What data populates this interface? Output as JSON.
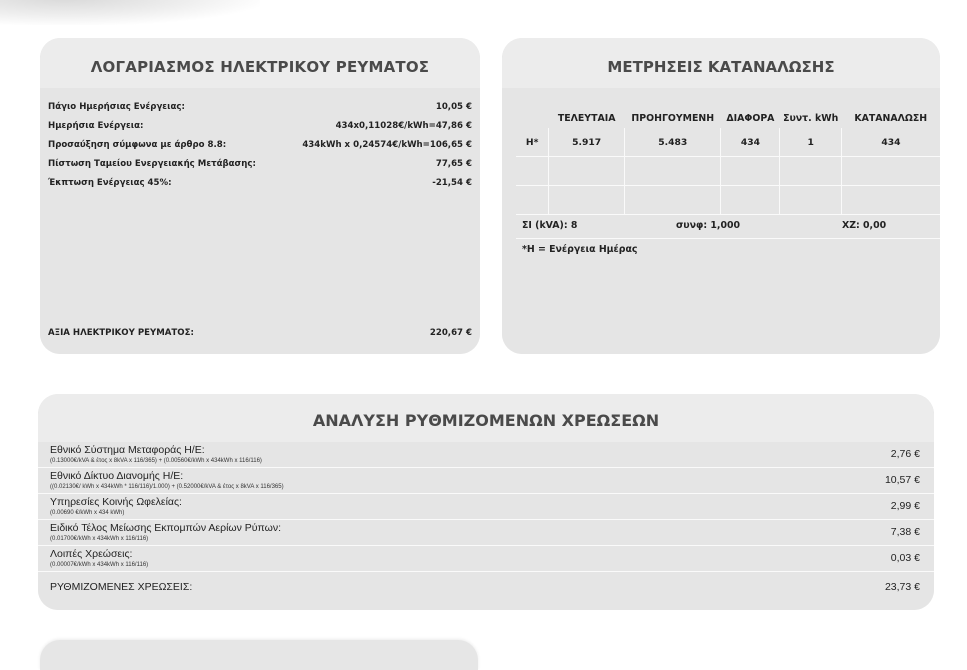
{
  "electricity_bill": {
    "title": "ΛΟΓΑΡΙΑΣΜΟΣ ΗΛΕΚΤΡΙΚΟΥ ΡΕΥΜΑΤΟΣ",
    "rows": [
      {
        "label": "Πάγιο Ημερήσιας Ενέργειας:",
        "value": "10,05 €"
      },
      {
        "label": "Ημερήσια Ενέργεια:",
        "value": "434x0,11028€/kWh=47,86 €"
      },
      {
        "label": "Προσαύξηση σύμφωνα με άρθρο 8.8:",
        "value": "434kWh x 0,24574€/kWh=106,65 €"
      },
      {
        "label": "Πίστωση Ταμείου Ενεργειακής Μετάβασης:",
        "value": "77,65 €"
      },
      {
        "label": "Έκπτωση Ενέργειας 45%:",
        "value": "-21,54 €"
      }
    ],
    "total_label": "ΑΞΙΑ ΗΛΕΚΤΡΙΚΟΥ ΡΕΥΜΑΤΟΣ:",
    "total_value": "220,67 €"
  },
  "measurements": {
    "title": "ΜΕΤΡΗΣΕΙΣ ΚΑΤΑΝΑΛΩΣΗΣ",
    "headers": [
      "",
      "ΤΕΛΕΥΤΑΙΑ",
      "ΠΡΟΗΓΟΥΜΕΝΗ",
      "ΔΙΑΦΟΡΑ",
      "Συντ. kWh",
      "ΚΑΤΑΝΑΛΩΣΗ"
    ],
    "rows": [
      [
        "Η*",
        "5.917",
        "5.483",
        "434",
        "1",
        "434"
      ],
      [
        "",
        "",
        "",
        "",
        "",
        ""
      ],
      [
        "",
        "",
        "",
        "",
        "",
        ""
      ]
    ],
    "si": "ΣΙ (kVA): 8",
    "cosphi": "συνφ: 1,000",
    "xz": "ΧΖ: 0,00",
    "note": "*Η = Ενέργεια Ημέρας"
  },
  "regulated_charges": {
    "title": "ΑΝΑΛΥΣΗ ΡΥΘΜΙΖΟΜΕΝΩΝ ΧΡΕΩΣΕΩΝ",
    "rows": [
      {
        "label": "Εθνικό Σύστημα Μεταφοράς Η/Ε:",
        "detail": "(0.13000€/kVA & έτος x 8kVA x 116/365) + (0.00560€/kWh x 434kWh x 116/116)",
        "value": "2,76 €"
      },
      {
        "label": "Εθνικό Δίκτυο Διανομής Η/Ε:",
        "detail": "((0.02130€/ kWh x 434kWh * 116/116)/1.000) + (0.52000€/kVA & έτος x 8kVA x 116/365)",
        "value": "10,57 €"
      },
      {
        "label": "Υπηρεσίες Κοινής Ωφελείας:",
        "detail": "(0.00690 €/kWh x 434 kWh)",
        "value": "2,99 €"
      },
      {
        "label": "Ειδικό Τέλος Μείωσης Εκπομπών Αερίων Ρύπων:",
        "detail": "(0.01700€/kWh x 434kWh x 116/116)",
        "value": "7,38 €"
      },
      {
        "label": "Λοιπές Χρεώσεις:",
        "detail": "(0.00007€/kWh x 434kWh x 116/116)",
        "value": "0,03 €"
      }
    ],
    "total_label": "ΡΥΘΜΙΖΟΜΕΝΕΣ ΧΡΕΩΣΕΙΣ:",
    "total_value": "23,73 €"
  }
}
